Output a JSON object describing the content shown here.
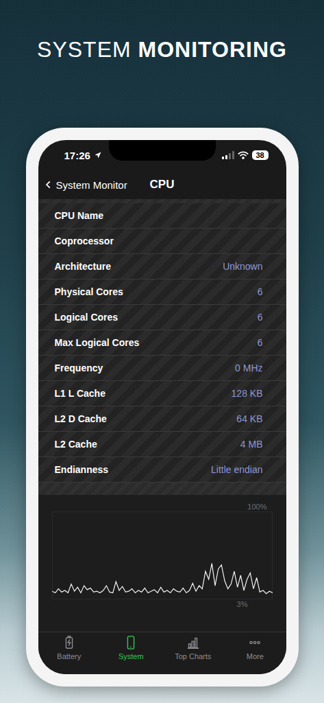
{
  "header": {
    "title_light": "SYSTEM",
    "title_bold": "MONITORING"
  },
  "status_bar": {
    "time": "17:26",
    "battery": "38"
  },
  "nav": {
    "back_label": "System Monitor",
    "title": "CPU"
  },
  "rows": [
    {
      "label": "CPU Name"
    },
    {
      "label": "Coprocessor"
    },
    {
      "label": "Architecture",
      "value": "Unknown"
    },
    {
      "label": "Physical Cores",
      "value": "6"
    },
    {
      "label": "Logical Cores",
      "value": "6"
    },
    {
      "label": "Max Logical Cores",
      "value": "6"
    },
    {
      "label": "Frequency",
      "value": "0 MHz"
    },
    {
      "label": "L1 L Cache",
      "value": "128 KB"
    },
    {
      "label": "L2 D Cache",
      "value": "64 KB"
    },
    {
      "label": "L2 Cache",
      "value": "4 MB"
    },
    {
      "label": "Endianness",
      "value": "Little endian"
    }
  ],
  "chart": {
    "max_label": "100%",
    "min_label": "3%",
    "values": [
      5,
      3,
      8,
      4,
      6,
      3,
      14,
      5,
      10,
      3,
      12,
      7,
      9,
      4,
      5,
      3,
      6,
      12,
      4,
      3,
      17,
      6,
      11,
      4,
      5,
      8,
      3,
      6,
      4,
      9,
      3,
      5,
      7,
      3,
      10,
      4,
      6,
      3,
      8,
      5,
      4,
      9,
      3,
      6,
      15,
      5,
      12,
      8,
      30,
      20,
      40,
      12,
      33,
      38,
      18,
      8,
      14,
      30,
      10,
      25,
      6,
      20,
      28,
      8,
      22,
      4,
      6,
      2,
      5,
      3
    ]
  },
  "tabs": [
    {
      "label": "Battery",
      "selected": false
    },
    {
      "label": "System",
      "selected": true
    },
    {
      "label": "Top Charts",
      "selected": false
    },
    {
      "label": "More",
      "selected": false
    }
  ]
}
